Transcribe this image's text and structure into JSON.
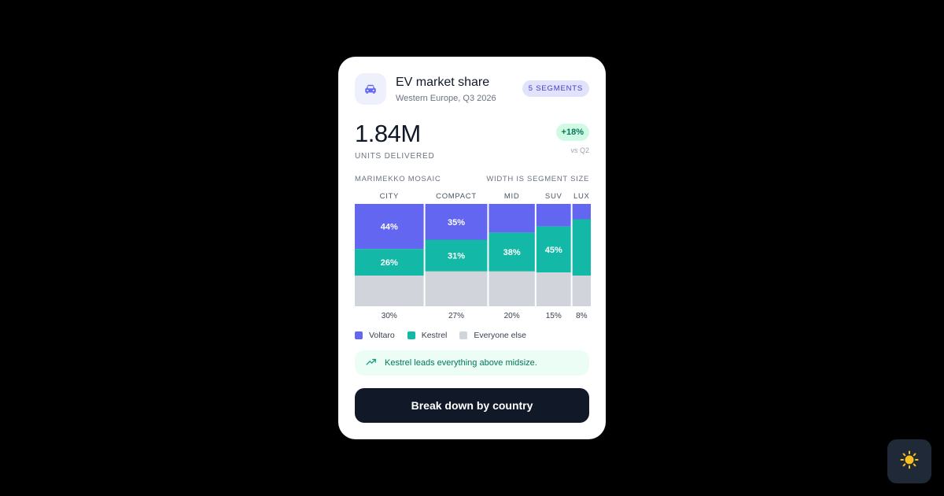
{
  "card": {
    "title": "EV market share",
    "subtitle": "Western Europe, Q3 2026",
    "badge": "5 SEGMENTS",
    "icon": "car-icon",
    "metric": {
      "value": "1.84M",
      "label": "UNITS DELIVERED",
      "delta": "+18%",
      "delta_sub": "vs Q2"
    },
    "section_left": "MARIMEKKO MOSAIC",
    "section_right": "WIDTH IS SEGMENT SIZE",
    "insight": "Kestrel leads everything above midsize.",
    "insight_icon": "trend-up-icon",
    "cta": "Break down by country"
  },
  "theme_toggle": {
    "icon": "sun-icon"
  },
  "colors": {
    "voltaro": "#6366f1",
    "kestrel": "#14b8a6",
    "others": "#d1d5db",
    "accent": "#4338ca"
  },
  "chart_data": {
    "type": "marimekko",
    "categories": [
      "CITY",
      "COMPACT",
      "MID",
      "SUV",
      "LUX"
    ],
    "widths": [
      30,
      27,
      20,
      15,
      8
    ],
    "width_labels": [
      "30%",
      "27%",
      "20%",
      "15%",
      "8%"
    ],
    "series": [
      {
        "name": "Voltaro",
        "values": [
          44,
          35,
          28,
          22,
          15
        ],
        "labels": [
          "44%",
          "35%",
          "",
          "",
          ""
        ]
      },
      {
        "name": "Kestrel",
        "values": [
          26,
          31,
          38,
          45,
          55
        ],
        "labels": [
          "26%",
          "31%",
          "38%",
          "45%",
          ""
        ]
      },
      {
        "name": "Everyone else",
        "values": [
          30,
          34,
          34,
          33,
          30
        ],
        "labels": [
          "",
          "",
          "",
          "",
          ""
        ]
      }
    ]
  }
}
